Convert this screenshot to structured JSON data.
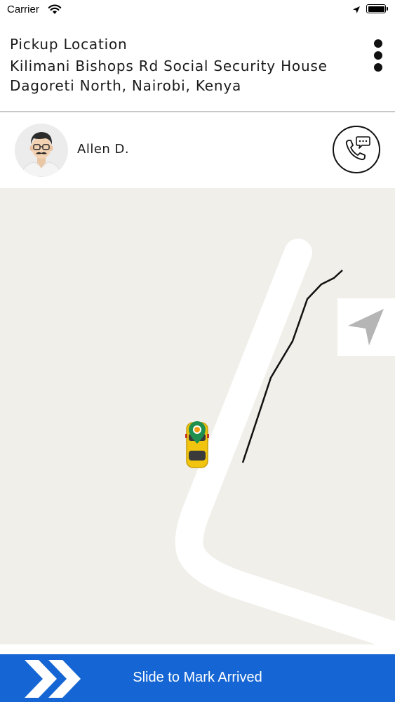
{
  "status_bar": {
    "carrier": "Carrier",
    "wifi_icon": "wifi-icon",
    "location_icon": "location-arrow-icon",
    "battery_icon": "battery-full-icon"
  },
  "pickup": {
    "title": "Pickup Location",
    "address": "Kilimani Bishops Rd Social Security House Dagoreti North, Nairobi, Kenya",
    "menu_icon": "more-vertical-icon"
  },
  "driver": {
    "name": "Allen D.",
    "avatar_icon": "driver-avatar",
    "call_icon": "phone-chat-icon"
  },
  "map": {
    "recenter_icon": "navigation-arrow-icon",
    "vehicle_icon": "taxi-car-icon",
    "marker_icon": "pickup-pin-icon"
  },
  "slider": {
    "label": "Slide to Mark Arrived",
    "handle_icon": "double-chevron-right-icon",
    "color": "#1566d4"
  }
}
